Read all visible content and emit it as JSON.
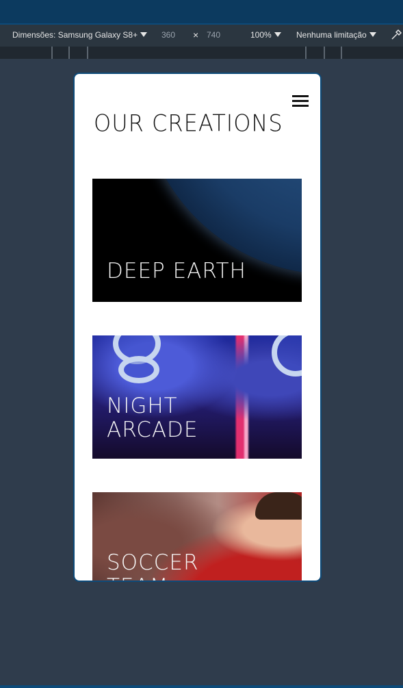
{
  "devtools": {
    "dimensions_label": "Dimensões: Samsung Galaxy S8+",
    "width": "360",
    "times": "×",
    "height": "740",
    "zoom": "100%",
    "throttling": "Nenhuma limitação"
  },
  "page": {
    "title": "OUR CREATIONS",
    "menu_icon": "hamburger-menu-icon",
    "cards": [
      {
        "label_line1": "DEEP EARTH",
        "label_line2": ""
      },
      {
        "label_line1": "NIGHT",
        "label_line2": "ARCADE"
      },
      {
        "label_line1": "SOCCER",
        "label_line2": "TEAM"
      }
    ]
  },
  "colors": {
    "devtools_bg": "#2b3640",
    "page_bg": "#2f3c4c",
    "accent": "#0d4b7a",
    "card_text": "#f6f6f6"
  }
}
